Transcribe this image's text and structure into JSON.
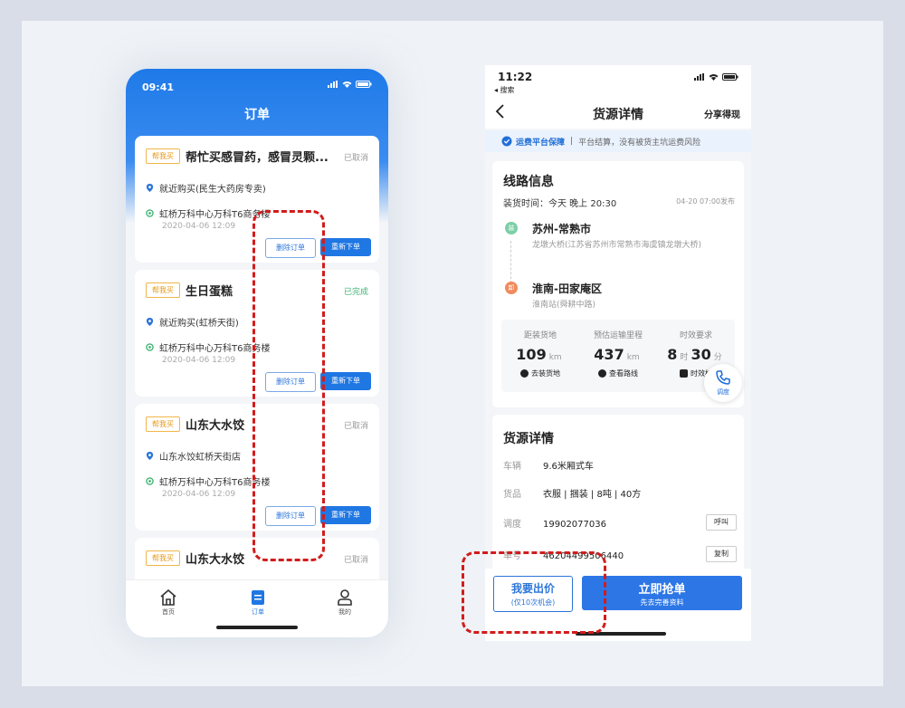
{
  "left": {
    "status_time": "09:41",
    "title": "订单",
    "orders": [
      {
        "tag": "帮我买",
        "title": "帮忙买感冒药，感冒灵颗...",
        "status": "已取消",
        "from": "就近购买(民生大药房专卖)",
        "to": "虹桥万科中心万科T6商务楼",
        "date": "2020-04-06  12:09",
        "delete": "删除订单",
        "reorder": "重新下单"
      },
      {
        "tag": "帮我买",
        "title": "生日蛋糕",
        "status": "已完成",
        "from": "就近购买(虹桥天街)",
        "to": "虹桥万科中心万科T6商务楼",
        "date": "2020-04-06  12:09",
        "delete": "删除订单",
        "reorder": "重新下单"
      },
      {
        "tag": "帮我买",
        "title": "山东大水饺",
        "status": "已取消",
        "from": "山东水饺虹桥天街店",
        "to": "虹桥万科中心万科T6商务楼",
        "date": "2020-04-06  12:09",
        "delete": "删除订单",
        "reorder": "重新下单"
      },
      {
        "tag": "帮我买",
        "title": "山东大水饺",
        "status": "已取消"
      }
    ],
    "tabs": [
      {
        "label": "首页",
        "icon": "home-icon"
      },
      {
        "label": "订单",
        "icon": "order-icon"
      },
      {
        "label": "我的",
        "icon": "profile-icon"
      }
    ]
  },
  "right": {
    "status_time": "11:22",
    "back_app": "◂ 搜索",
    "nav_title": "货源详情",
    "share": "分享得现",
    "guarantee_title": "运费平台保障",
    "guarantee_text": "平台结算，没有被货主坑运费风险",
    "route": {
      "heading": "线路信息",
      "load_time": "装货时间：今天 晚上 20:30",
      "published": "04-20 07:00发布",
      "from_node": "装",
      "from_city": "苏州-常熟市",
      "from_addr": "龙墩大桥(江苏省苏州市常熟市海虞镇龙墩大桥)",
      "to_node": "卸",
      "to_city": "淮南-田家庵区",
      "to_addr": "淮南站(舜耕中路)",
      "stats": [
        {
          "label": "距装货地",
          "value": "109",
          "unit": "km",
          "action": "去装货地"
        },
        {
          "label": "预估运输里程",
          "value": "437",
          "unit": "km",
          "action": "查看路线"
        },
        {
          "label": "时效要求",
          "value": "8",
          "unit": "时",
          "value2": "30",
          "unit2": "分",
          "action": "时效标"
        }
      ],
      "dispatch_label": "调度"
    },
    "cargo": {
      "heading": "货源详情",
      "rows": [
        {
          "key": "车辆",
          "value": "9.6米厢式车"
        },
        {
          "key": "货品",
          "value": "衣服 | 捆装 | 8吨 | 40方"
        },
        {
          "key": "调度",
          "value": "19902077036",
          "action": "呼叫"
        },
        {
          "key": "单号",
          "value": "46204499506440",
          "action": "复制"
        }
      ]
    },
    "bid_label": "我要出价",
    "bid_sub": "(仅10次机会)",
    "grab_label": "立即抢单",
    "grab_sub": "先去完善资料"
  }
}
